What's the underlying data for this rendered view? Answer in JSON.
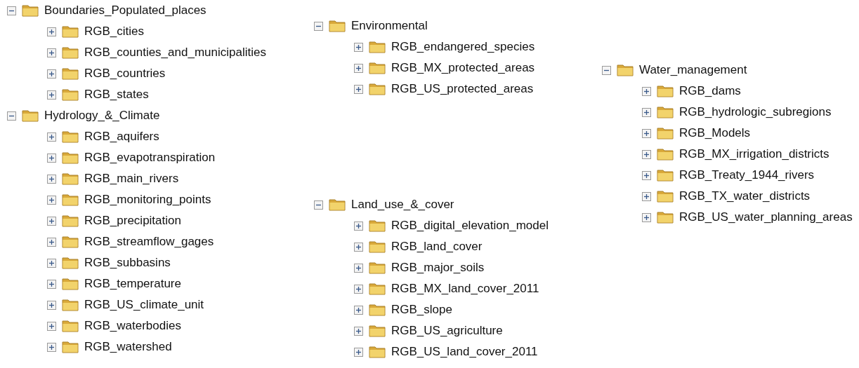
{
  "columns": [
    {
      "trees": [
        {
          "label": "Boundaries_Populated_places",
          "expanded": true,
          "children": [
            {
              "label": "RGB_cities",
              "expanded": false
            },
            {
              "label": "RGB_counties_and_municipalities",
              "expanded": false
            },
            {
              "label": "RGB_countries",
              "expanded": false
            },
            {
              "label": "RGB_states",
              "expanded": false
            }
          ]
        },
        {
          "label": "Hydrology_&_Climate",
          "expanded": true,
          "children": [
            {
              "label": "RGB_aquifers",
              "expanded": false
            },
            {
              "label": "RGB_evapotranspiration",
              "expanded": false
            },
            {
              "label": "RGB_main_rivers",
              "expanded": false
            },
            {
              "label": "RGB_monitoring_points",
              "expanded": false
            },
            {
              "label": "RGB_precipitation",
              "expanded": false
            },
            {
              "label": "RGB_streamflow_gages",
              "expanded": false
            },
            {
              "label": "RGB_subbasins",
              "expanded": false
            },
            {
              "label": "RGB_temperature",
              "expanded": false
            },
            {
              "label": "RGB_US_climate_unit",
              "expanded": false
            },
            {
              "label": "RGB_waterbodies",
              "expanded": false
            },
            {
              "label": "RGB_watershed",
              "expanded": false
            }
          ]
        }
      ]
    },
    {
      "trees": [
        {
          "label": "Environmental",
          "expanded": true,
          "children": [
            {
              "label": "RGB_endangered_species",
              "expanded": false
            },
            {
              "label": "RGB_MX_protected_areas",
              "expanded": false
            },
            {
              "label": "RGB_US_protected_areas",
              "expanded": false
            }
          ]
        },
        {
          "label": "Land_use_&_cover",
          "expanded": true,
          "children": [
            {
              "label": "RGB_digital_elevation_model",
              "expanded": false
            },
            {
              "label": "RGB_land_cover",
              "expanded": false
            },
            {
              "label": "RGB_major_soils",
              "expanded": false
            },
            {
              "label": "RGB_MX_land_cover_2011",
              "expanded": false
            },
            {
              "label": "RGB_slope",
              "expanded": false
            },
            {
              "label": "RGB_US_agriculture",
              "expanded": false
            },
            {
              "label": "RGB_US_land_cover_2011",
              "expanded": false
            }
          ]
        }
      ]
    },
    {
      "trees": [
        {
          "label": "Water_management",
          "expanded": true,
          "children": [
            {
              "label": "RGB_dams",
              "expanded": false
            },
            {
              "label": "RGB_hydrologic_subregions",
              "expanded": false
            },
            {
              "label": "RGB_Models",
              "expanded": false
            },
            {
              "label": "RGB_MX_irrigation_districts",
              "expanded": false
            },
            {
              "label": "RGB_Treaty_1944_rivers",
              "expanded": false
            },
            {
              "label": "RGB_TX_water_districts",
              "expanded": false
            },
            {
              "label": "RGB_US_water_planning_areas",
              "expanded": false
            }
          ]
        }
      ]
    }
  ]
}
